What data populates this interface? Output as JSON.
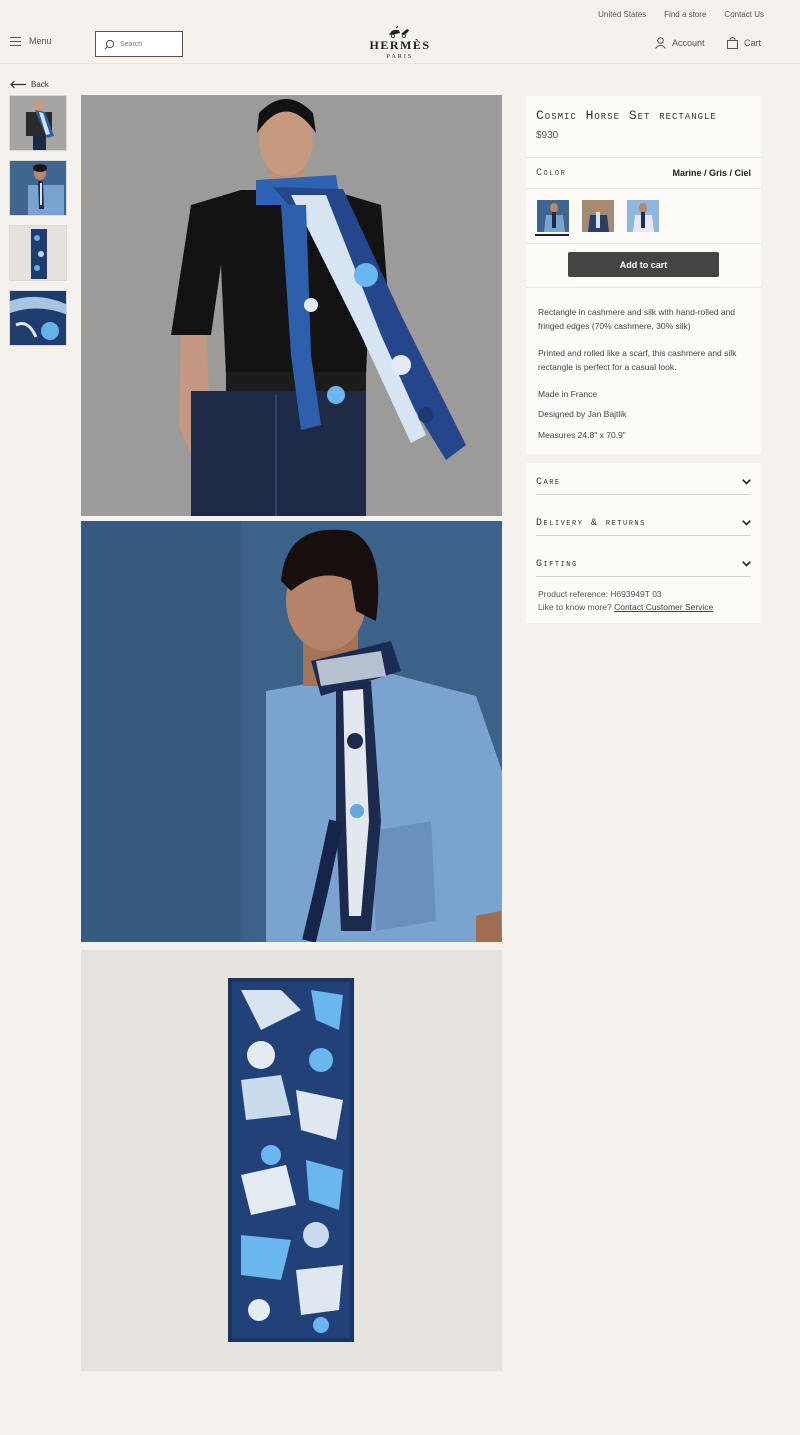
{
  "utility": {
    "country": "United States",
    "find_store": "Find a store",
    "contact": "Contact Us"
  },
  "header": {
    "menu_label": "Menu",
    "search_placeholder": "Search",
    "logo": "HERMÈS",
    "logo_sub": "PARIS",
    "account_label": "Account",
    "cart_label": "Cart"
  },
  "nav": {
    "back_label": "Back"
  },
  "product": {
    "title": "Cosmic Horse Set rectangle",
    "price": "$930",
    "color_label": "Color",
    "color_value": "Marine / Gris / Ciel",
    "add_to_cart": "Add to cart",
    "description": [
      "Rectangle in cashmere and silk with hand-rolled and fringed edges (70% cashmere, 30% silk)",
      "Printed and rolled like a scarf, this cashmere and silk rectangle is perfect for a casual look.",
      "Made in France",
      "Designed by Jan Bajtlik",
      "Measures 24.8\" x 70.9\""
    ]
  },
  "accordion": {
    "care": "Care",
    "delivery": "Delivery & returns",
    "gifting": "Gifting"
  },
  "reference": {
    "text": "Product reference:  H693949T 03",
    "more_prefix": "Like to know more? ",
    "more_link": "Contact Customer Service"
  },
  "colors": {
    "background": "#f5f1ec",
    "panel": "#fdfbf8",
    "button": "#444444",
    "scarf_navy": "#1c3b73",
    "scarf_sky": "#5fa8e0"
  }
}
